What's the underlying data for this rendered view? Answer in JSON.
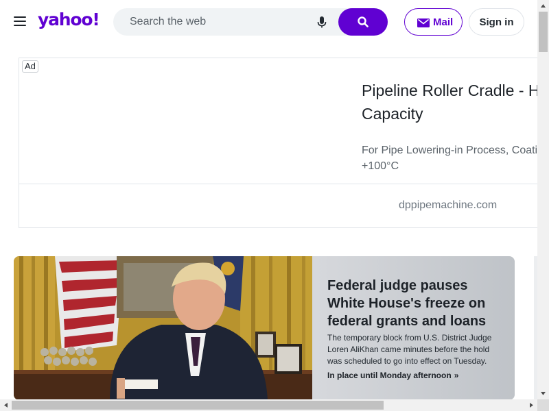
{
  "header": {
    "logo_text": "yahoo!",
    "search_placeholder": "Search the web",
    "mail_label": "Mail",
    "signin_label": "Sign in",
    "icons": [
      "hamburger-menu-icon",
      "microphone-icon",
      "search-icon",
      "mail-envelope-icon"
    ]
  },
  "ad": {
    "badge": "Ad",
    "title": "Pipeline Roller Cradle - H\nCapacity",
    "description": "For Pipe Lowering-in Process, Coati\n+100°C",
    "domain": "dppipemachine.com"
  },
  "hero": {
    "title": "Federal judge pauses White House's freeze on federal grants and loans",
    "summary": "The temporary block from U.S. District Judge Loren AliKhan came minutes before the hold was scheduled to go into effect on Tuesday.",
    "link_label": "In place until Monday afternoon",
    "link_chevron": "»"
  },
  "colors": {
    "brand": "#6001d2",
    "text": "#1d2228",
    "muted": "#5b636a"
  }
}
